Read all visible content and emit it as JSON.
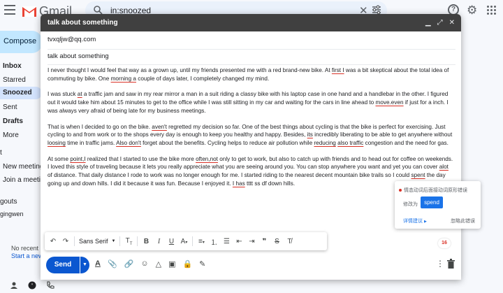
{
  "app": {
    "name": "Gmail"
  },
  "search": {
    "query": "in:snoozed"
  },
  "sidebar": {
    "compose_label": "Compose",
    "items": [
      {
        "label": "Inbox",
        "bold": true
      },
      {
        "label": "Starred"
      },
      {
        "label": "Snoozed",
        "selected": true
      },
      {
        "label": "Sent"
      },
      {
        "label": "Drafts",
        "bold": true
      },
      {
        "label": "More"
      }
    ],
    "meet_label_1": "New meeting",
    "meet_label_2": "Join a meeting",
    "hangouts_label": "gouts",
    "user_label": "gingwen",
    "no_recent": "No recent",
    "start_new": "Start a new"
  },
  "compose": {
    "title": "talk about something",
    "to": "tvxqljw@qq.com",
    "subject": "talk about something",
    "paragraphs": [
      [
        {
          "t": "I never thought I would feel that way as a grown up, until my friends presented me with a red brand-new bike. At "
        },
        {
          "t": "first I",
          "err": true
        },
        {
          "t": " was a bit skeptical about the total idea of commuting by bike. One "
        },
        {
          "t": "morning a",
          "err": true
        },
        {
          "t": " couple of days later, I completely changed my mind."
        }
      ],
      [
        {
          "t": "I was stuck "
        },
        {
          "t": "at",
          "err": true
        },
        {
          "t": " a traffic jam and saw in my rear mirror a man in a suit riding a classy bike with his laptop case in one hand and a handlebar in the other. I figured out it would take him about 15 minutes to get to the office while I was still sitting in my car and waiting for the cars in line ahead to "
        },
        {
          "t": "move.even",
          "err": true
        },
        {
          "t": " if just for a inch. I was always very afraid of being late for my business meetings."
        }
      ],
      [
        {
          "t": "That is when I decided to go on the bike. "
        },
        {
          "t": "aven't",
          "err": true
        },
        {
          "t": " regretted my decision so far. One of the best things about cycling is that the bike is perfect for exercising. Just cycling to and from work or to the shops every day is enough to keep you healthy and happy. Besides, "
        },
        {
          "t": "its",
          "err": true
        },
        {
          "t": " incredibly liberating to be able to get anywhere without "
        },
        {
          "t": "loosing",
          "err": true
        },
        {
          "t": " time in traffic jams. "
        },
        {
          "t": "Also don't",
          "err": true
        },
        {
          "t": " forget about the benefits. Cycling helps to reduce air pollution while "
        },
        {
          "t": "reducing",
          "err": true
        },
        {
          "t": " "
        },
        {
          "t": "also traffic",
          "err": true
        },
        {
          "t": " congestion and the need for gas."
        }
      ],
      [
        {
          "t": "At some "
        },
        {
          "t": "point,I",
          "err": true
        },
        {
          "t": " realized that I started to use the bike more "
        },
        {
          "t": "often,not",
          "err": true
        },
        {
          "t": " only to get to work, but also to catch up with friends and to head out for coffee on weekends. I loved this style of traveling because it lets you really appreciate what you are seeing around you. You can stop anywhere you want and yet you can cover "
        },
        {
          "t": "alot",
          "err": true
        },
        {
          "t": " of distance. That daily distance I rode to work was no longer enough for me. I started riding to the nearest decent mountain bike trails so I could "
        },
        {
          "t": "spent",
          "err": true
        },
        {
          "t": " the day going up and down hills. I did it because it was fun. Because I enjoyed it. "
        },
        {
          "t": "I has",
          "err": true
        },
        {
          "t": " tttt ss df down hills."
        }
      ]
    ],
    "font_label": "Sans Serif",
    "send_label": "Send"
  },
  "grammar_popup": {
    "error_type": "情态动词后面接动词原形错误",
    "change_to_label": "修改为",
    "suggestion": "spend",
    "details_label": "详情建议",
    "ignore_label": "忽略此错误"
  },
  "error_count": "16",
  "colors": {
    "accent": "#0b57d0",
    "error": "#d93025",
    "header": "#404040"
  }
}
